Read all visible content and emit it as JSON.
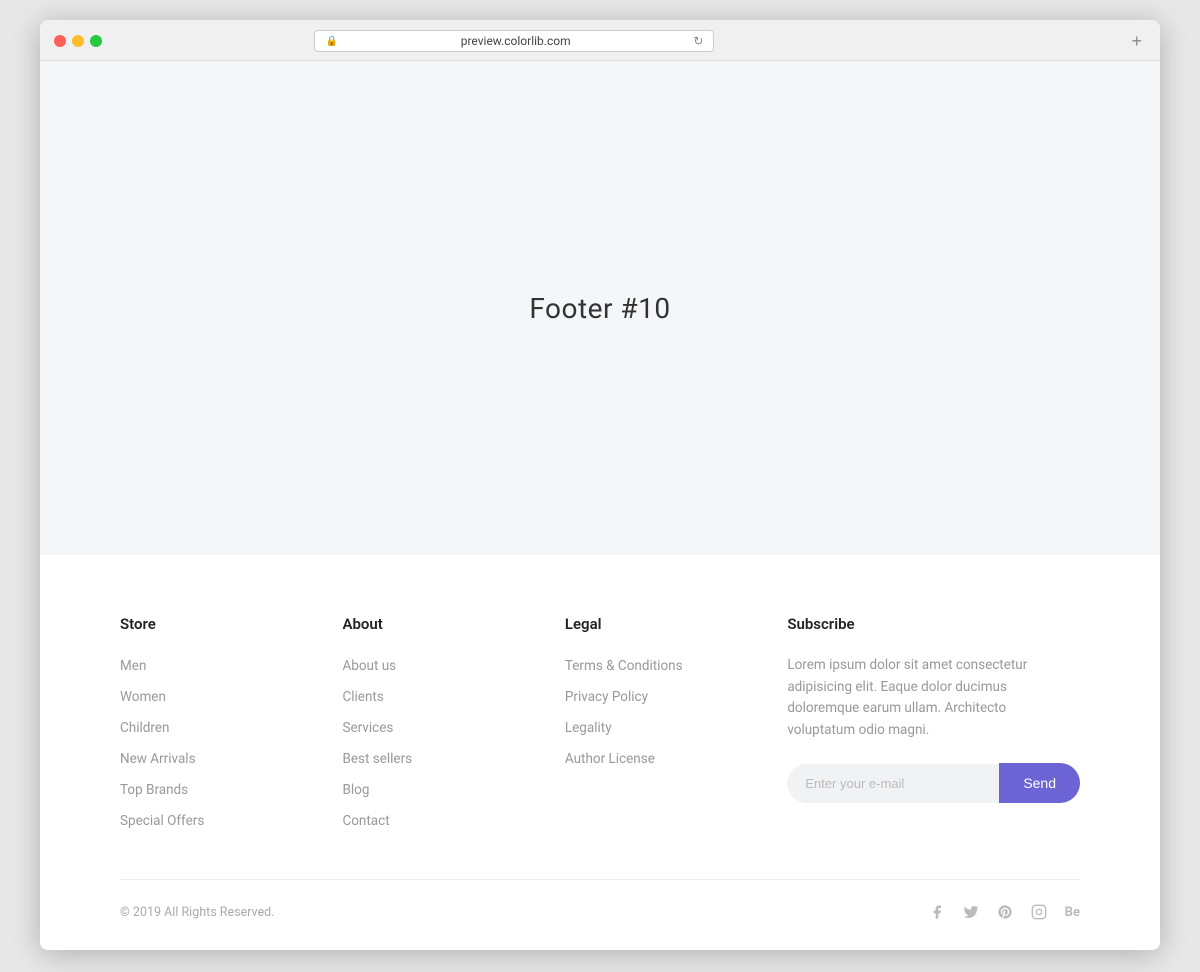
{
  "browser": {
    "url": "preview.colorlib.com",
    "new_tab_label": "+"
  },
  "main": {
    "title": "Footer #10"
  },
  "footer": {
    "store": {
      "heading": "Store",
      "links": [
        "Men",
        "Women",
        "Children",
        "New Arrivals",
        "Top Brands",
        "Special Offers"
      ]
    },
    "about": {
      "heading": "About",
      "links": [
        "About us",
        "Clients",
        "Services",
        "Best sellers",
        "Blog",
        "Contact"
      ]
    },
    "legal": {
      "heading": "Legal",
      "links": [
        "Terms & Conditions",
        "Privacy Policy",
        "Legality",
        "Author License"
      ]
    },
    "subscribe": {
      "heading": "Subscribe",
      "description": "Lorem ipsum dolor sit amet consectetur adipisicing elit. Eaque dolor ducimus doloremque earum ullam. Architecto voluptatum odio magni.",
      "input_placeholder": "Enter your e-mail",
      "button_label": "Send"
    },
    "bottom": {
      "copyright": "© 2019 All Rights Reserved.",
      "social_labels": [
        "facebook",
        "twitter",
        "pinterest",
        "instagram",
        "behance"
      ]
    }
  }
}
